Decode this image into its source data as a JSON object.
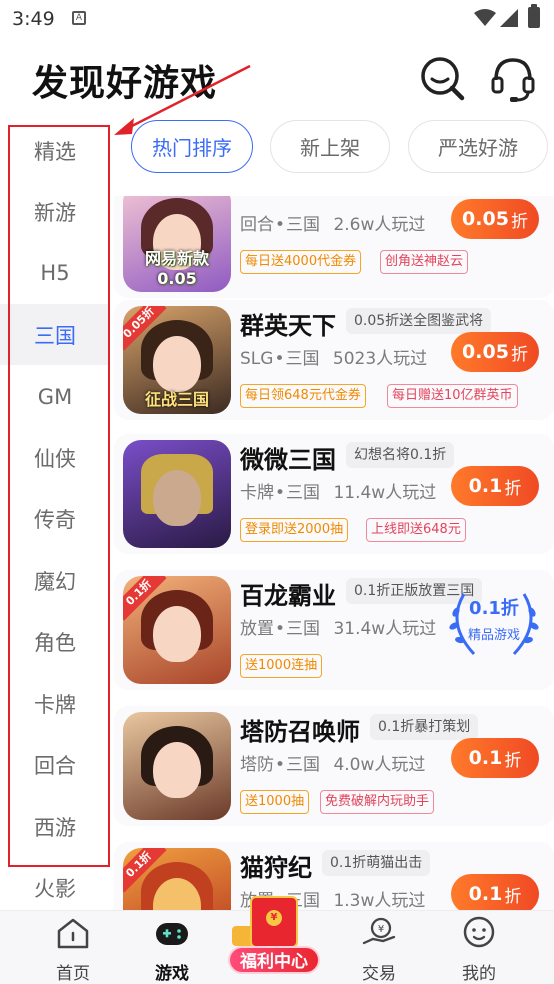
{
  "status_bar": {
    "time": "3:49",
    "sim_icon": "sim-card-icon"
  },
  "header": {
    "title": "发现好游戏",
    "icons": [
      "search-icon",
      "headset-icon"
    ]
  },
  "tabs": [
    {
      "label": "热门排序",
      "active": true
    },
    {
      "label": "新上架",
      "active": false
    },
    {
      "label": "严选好游",
      "active": false
    }
  ],
  "sidebar": {
    "items": [
      {
        "label": "精选"
      },
      {
        "label": "新游"
      },
      {
        "label": "H5"
      },
      {
        "label": "三国",
        "active": true
      },
      {
        "label": "GM"
      },
      {
        "label": "仙侠"
      },
      {
        "label": "传奇"
      },
      {
        "label": "魔幻"
      },
      {
        "label": "角色"
      },
      {
        "label": "卡牌"
      },
      {
        "label": "回合"
      },
      {
        "label": "西游"
      },
      {
        "label": "火影"
      }
    ]
  },
  "games": [
    {
      "name": "",
      "thumb_text": "网易新款0.05",
      "genre": "回合",
      "theme": "三国",
      "players": "2.6w人玩过",
      "discount": "0.05",
      "discount_unit": "折",
      "tags": [
        {
          "text": "每日送4000代金券",
          "color": "orange"
        },
        {
          "text": "创角送神赵云",
          "color": "red"
        }
      ]
    },
    {
      "name": "群英天下",
      "promo": "0.05折送全图鉴武将",
      "thumb_badge": "0.05折",
      "thumb_text": "征战三国",
      "genre": "SLG",
      "theme": "三国",
      "players": "5023人玩过",
      "discount": "0.05",
      "discount_unit": "折",
      "tags": [
        {
          "text": "每日领648元代金券",
          "color": "orange"
        },
        {
          "text": "每日赠送10亿群英币",
          "color": "red"
        }
      ]
    },
    {
      "name": "微微三国",
      "promo": "幻想名将0.1折",
      "genre": "卡牌",
      "theme": "三国",
      "players": "11.4w人玩过",
      "discount": "0.1",
      "discount_unit": "折",
      "tags": [
        {
          "text": "登录即送2000抽",
          "color": "orange"
        },
        {
          "text": "上线即送648元",
          "color": "red"
        }
      ]
    },
    {
      "name": "百龙霸业",
      "promo": "0.1折正版放置三国",
      "thumb_badge": "0.1折",
      "genre": "放置",
      "theme": "三国",
      "players": "31.4w人玩过",
      "badge_value": "0.1折",
      "badge_label": "精品游戏",
      "tags": [
        {
          "text": "送1000连抽",
          "color": "orange"
        }
      ]
    },
    {
      "name": "塔防召唤师",
      "promo": "0.1折暴打策划",
      "genre": "塔防",
      "theme": "三国",
      "players": "4.0w人玩过",
      "discount": "0.1",
      "discount_unit": "折",
      "tags": [
        {
          "text": "送1000抽",
          "color": "orange"
        },
        {
          "text": "免费破解内玩助手",
          "color": "red"
        }
      ]
    },
    {
      "name": "猫狩纪",
      "promo": "0.1折萌猫出击",
      "thumb_badge": "0.1折",
      "genre": "放置",
      "theme": "三国",
      "players": "1.3w人玩过",
      "discount": "0.1",
      "discount_unit": "折",
      "tags": []
    }
  ],
  "bottom_nav": {
    "items": [
      {
        "label": "首页",
        "icon": "home-icon"
      },
      {
        "label": "游戏",
        "icon": "gamepad-icon",
        "active": true
      },
      {
        "label": "福利中心",
        "icon": "red-envelope-icon"
      },
      {
        "label": "交易",
        "icon": "trade-icon"
      },
      {
        "label": "我的",
        "icon": "profile-icon"
      }
    ]
  },
  "colors": {
    "accent": "#3b6cf6",
    "discount": "#f04a24",
    "annotation": "#e0232a"
  }
}
